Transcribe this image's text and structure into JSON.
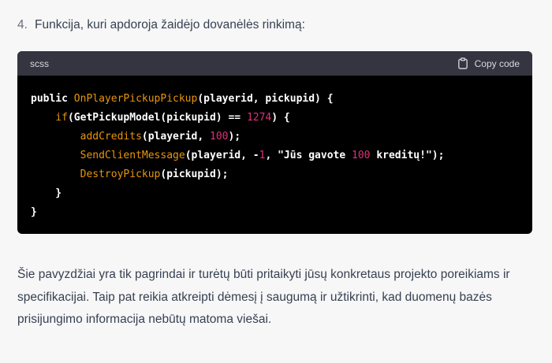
{
  "list": {
    "number": "4.",
    "text": "Funkcija, kuri apdoroja žaidėjo dovanėlės rinkimą:"
  },
  "code_block": {
    "language": "scss",
    "copy_label": "Copy code",
    "lines": [
      [
        {
          "t": "public ",
          "c": "kw"
        },
        {
          "t": "OnPlayerPickupPickup",
          "c": "tok-orange"
        },
        {
          "t": "(playerid, pickupid) {",
          "c": "kw"
        }
      ],
      [
        {
          "t": "    ",
          "c": "kw"
        },
        {
          "t": "if",
          "c": "tok-orange"
        },
        {
          "t": "(GetPickupModel(pickupid) == ",
          "c": "kw"
        },
        {
          "t": "1274",
          "c": "tok-pink"
        },
        {
          "t": ") {",
          "c": "kw"
        }
      ],
      [
        {
          "t": "        ",
          "c": "kw"
        },
        {
          "t": "addCredits",
          "c": "tok-orange"
        },
        {
          "t": "(playerid, ",
          "c": "kw"
        },
        {
          "t": "100",
          "c": "tok-pink"
        },
        {
          "t": ");",
          "c": "kw"
        }
      ],
      [
        {
          "t": "        ",
          "c": "kw"
        },
        {
          "t": "SendClientMessage",
          "c": "tok-orange"
        },
        {
          "t": "(playerid, -",
          "c": "kw"
        },
        {
          "t": "1",
          "c": "tok-pink"
        },
        {
          "t": ", \"Jūs gavote ",
          "c": "kw"
        },
        {
          "t": "100",
          "c": "tok-pink"
        },
        {
          "t": " kreditų!\");",
          "c": "kw"
        }
      ],
      [
        {
          "t": "        ",
          "c": "kw"
        },
        {
          "t": "DestroyPickup",
          "c": "tok-orange"
        },
        {
          "t": "(pickupid);",
          "c": "kw"
        }
      ],
      [
        {
          "t": "    }",
          "c": "kw"
        }
      ],
      [
        {
          "t": "}",
          "c": "kw"
        }
      ]
    ]
  },
  "paragraph": {
    "text": "Šie pavyzdžiai yra tik pagrindai ir turėtų būti pritaikyti jūsų konkretaus projekto poreikiams ir specifikacijai. Taip pat reikia atkreipti dėmesį į saugumą ir užtikrinti, kad duomenų bazės prisijungimo informacija nebūtų matoma viešai."
  },
  "icons": {
    "copy": "clipboard-icon"
  }
}
